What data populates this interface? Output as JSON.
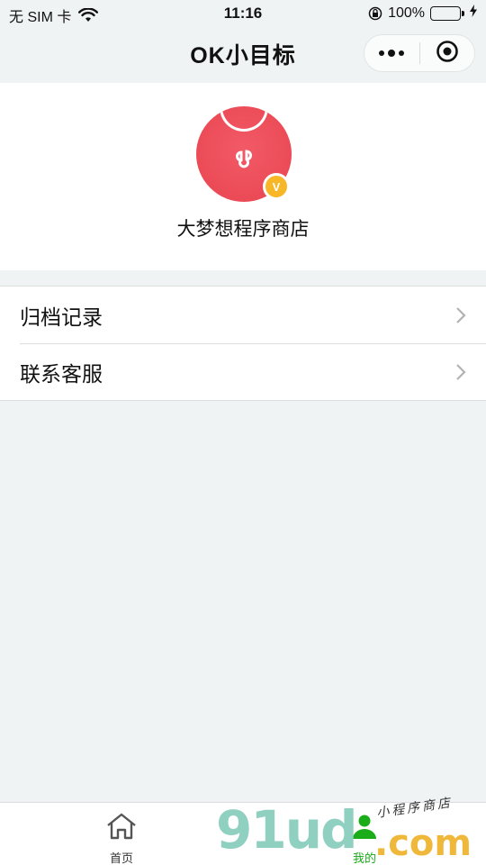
{
  "status_bar": {
    "carrier": "无 SIM 卡",
    "time": "11:16",
    "battery_percent": "100%",
    "battery_level": 1.0,
    "icons": [
      "wifi-icon",
      "orientation-lock-icon",
      "battery-icon",
      "charging-icon"
    ]
  },
  "nav": {
    "title": "OK小目标",
    "more_icon": "more-dots-icon",
    "close_icon": "target-close-icon"
  },
  "profile": {
    "shop_name": "大梦想程序商店",
    "avatar_icon": "mini-program-bag-icon",
    "badge_text": "V",
    "avatar_color": "#e8444f",
    "badge_color": "#f7b726"
  },
  "menu": {
    "items": [
      {
        "label": "归档记录",
        "icon": "chevron-right-icon"
      },
      {
        "label": "联系客服",
        "icon": "chevron-right-icon"
      }
    ]
  },
  "tabbar": {
    "tabs": [
      {
        "label": "首页",
        "icon": "home-icon",
        "active": false
      },
      {
        "label": "我的",
        "icon": "user-icon",
        "active": true
      }
    ],
    "active_color": "#1aad19"
  },
  "watermark": {
    "main": "91ud",
    "com": ".com",
    "sub": "小程序商店"
  }
}
